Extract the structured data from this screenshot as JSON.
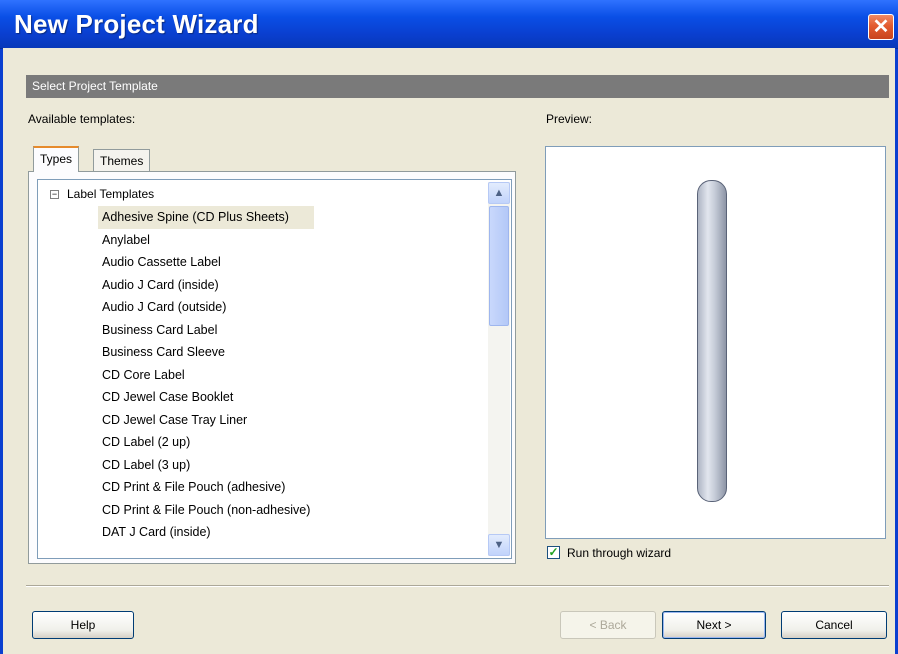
{
  "window": {
    "title": "New Project Wizard",
    "close_glyph": "✕"
  },
  "section_header": "Select Project Template",
  "available_label": "Available templates:",
  "preview_label": "Preview:",
  "tabs": [
    {
      "label": "Types",
      "active": true
    },
    {
      "label": "Themes",
      "active": false
    }
  ],
  "tree": {
    "root_expander": "−",
    "root_label": "Label Templates",
    "selected_index": 0,
    "items": [
      "Adhesive Spine (CD Plus Sheets)",
      "Anylabel",
      "Audio Cassette Label",
      "Audio J Card (inside)",
      "Audio J Card (outside)",
      "Business Card Label",
      "Business Card Sleeve",
      "CD Core Label",
      "CD Jewel Case Booklet",
      "CD Jewel Case Tray Liner",
      "CD Label (2 up)",
      "CD Label (3 up)",
      "CD Print & File Pouch (adhesive)",
      "CD Print & File Pouch (non-adhesive)",
      "DAT J Card (inside)"
    ],
    "scroll_up_glyph": "▲",
    "scroll_down_glyph": "▼"
  },
  "run_wizard": {
    "label": "Run through wizard",
    "checked": true,
    "check_glyph": "✓"
  },
  "buttons": {
    "help": "Help",
    "back": "< Back",
    "next": "Next >",
    "cancel": "Cancel"
  },
  "icons": {
    "close": "close-icon",
    "expander": "tree-collapse-icon",
    "scroll_up": "chevron-up-icon",
    "scroll_down": "chevron-down-icon",
    "check": "checkmark-icon"
  },
  "colors": {
    "titlebar": "#0a3fd0",
    "client_bg": "#ece9d8",
    "section_header_bg": "#7a7a7a",
    "close_button": "#e35b2f",
    "check": "#21a121"
  }
}
